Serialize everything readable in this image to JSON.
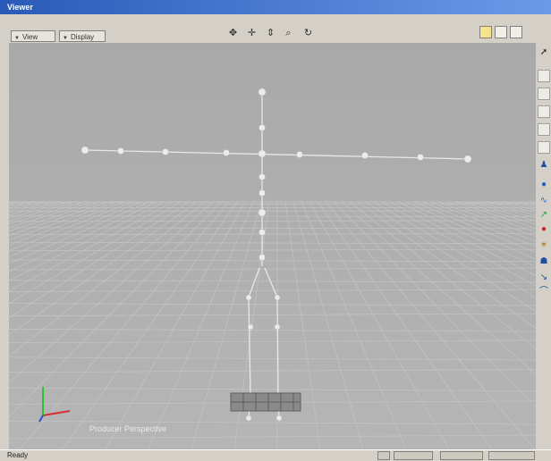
{
  "window": {
    "title": "Viewer"
  },
  "toolbar": {
    "view_menu": "View",
    "display_menu": "Display",
    "nav_icons": [
      "pan-icon",
      "move-icon",
      "dolly-icon",
      "zoom-icon",
      "orbit-icon"
    ],
    "layout_buttons": [
      "single-layout-icon",
      "split-layout-icon",
      "quad-layout-icon"
    ]
  },
  "viewport": {
    "label": "Producer Perspective",
    "axis_colors": {
      "x": "#d43030",
      "y": "#30c030",
      "z": "#3050d0"
    },
    "grid_color": "#c4c4c4",
    "background": "#a8a8a8"
  },
  "side_tools": [
    "select-arrow-icon",
    "blank-tool",
    "blank-tool",
    "blank-tool",
    "blank-tool",
    "blank-tool",
    "character-icon",
    "sphere-icon",
    "curve-icon",
    "path-icon",
    "red-dot-icon",
    "star-icon",
    "actor-icon",
    "arrow-tool-icon",
    "bend-icon"
  ],
  "status": {
    "text": "Ready"
  }
}
